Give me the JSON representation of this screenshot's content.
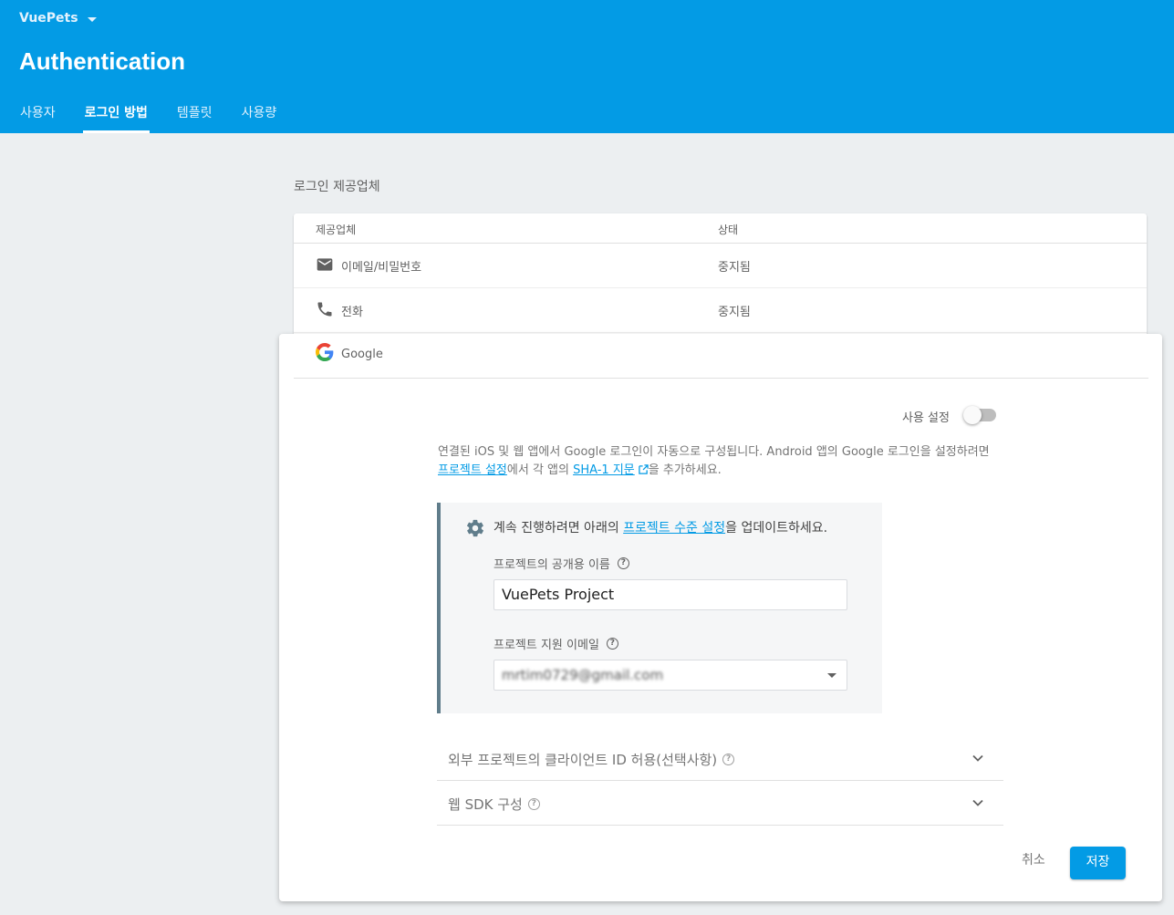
{
  "header": {
    "project_name": "VuePets",
    "title": "Authentication",
    "tabs": [
      {
        "label": "사용자",
        "active": false
      },
      {
        "label": "로그인 방법",
        "active": true
      },
      {
        "label": "템플릿",
        "active": false
      },
      {
        "label": "사용량",
        "active": false
      }
    ],
    "color": "#039be5"
  },
  "providers": {
    "section_label": "로그인 제공업체",
    "col_provider": "제공업체",
    "col_status": "상태",
    "rows": [
      {
        "icon": "mail-icon",
        "name": "이메일/비밀번호",
        "status": "중지됨"
      },
      {
        "icon": "phone-icon",
        "name": "전화",
        "status": "중지됨"
      }
    ]
  },
  "google_panel": {
    "provider_name": "Google",
    "enable_label": "사용 설정",
    "enabled": false,
    "description_1": "연결된 iOS 및 웹 앱에서 Google 로그인이 자동으로 구성됩니다. Android 앱의 Google 로그인을 설정하려면 ",
    "link_project_settings": "프로젝트 설정",
    "description_2": "에서 각 앱의 ",
    "link_sha1": "SHA-1 지문",
    "description_3": "을 추가하세요.",
    "notice_1": "계속 진행하려면 아래의 ",
    "notice_link": "프로젝트 수준 설정",
    "notice_2": "을 업데이트하세요.",
    "public_name_label": "프로젝트의 공개용 이름",
    "public_name_value": "VuePets Project",
    "support_email_label": "프로젝트 지원 이메일",
    "support_email_value": "mrtim0729@gmail.com",
    "expanders": [
      {
        "label": "외부 프로젝트의 클라이언트 ID 허용(선택사항)"
      },
      {
        "label": "웹 SDK 구성"
      }
    ],
    "cancel_label": "취소",
    "save_label": "저장",
    "help_glyph": "?"
  }
}
